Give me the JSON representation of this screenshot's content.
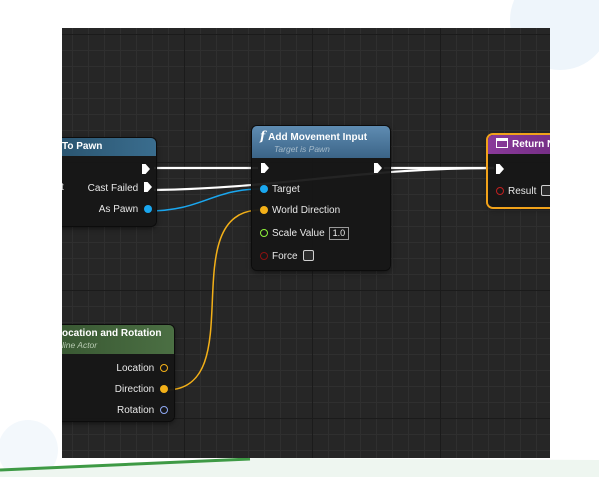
{
  "nodes": {
    "cast_to_pawn": {
      "title": "To Pawn",
      "pins": {
        "cast_failed": "Cast Failed",
        "as_pawn": "As Pawn",
        "truncated_left_label": "t"
      }
    },
    "add_movement_input": {
      "title": "Add Movement Input",
      "subtitle": "Target is Pawn",
      "icon": "function-icon",
      "pins": {
        "target": "Target",
        "world_direction": "World Direction",
        "scale_value": "Scale Value",
        "force": "Force"
      },
      "scale_value_default": "1.0"
    },
    "return_node": {
      "title": "Return N",
      "pins": {
        "result": "Result"
      }
    },
    "location_rotation": {
      "title": "ocation and Rotation",
      "subtitle": "line Actor",
      "pins": {
        "location": "Location",
        "direction": "Direction",
        "rotation": "Rotation"
      }
    }
  },
  "colors": {
    "exec": "#ffffff",
    "object_pin": "#1aa7ef",
    "vector_pin": "#f3b018",
    "float_pin": "#8ff43b",
    "bool_pin": "#8a1111",
    "rotator_pin": "#8fa9f4",
    "cast_header": "#2f5f7e",
    "function_header": "#4d7aa0",
    "return_header": "#7c2f8c",
    "pure_header": "#3e5f37",
    "selection_outline": "#f1a21a"
  }
}
